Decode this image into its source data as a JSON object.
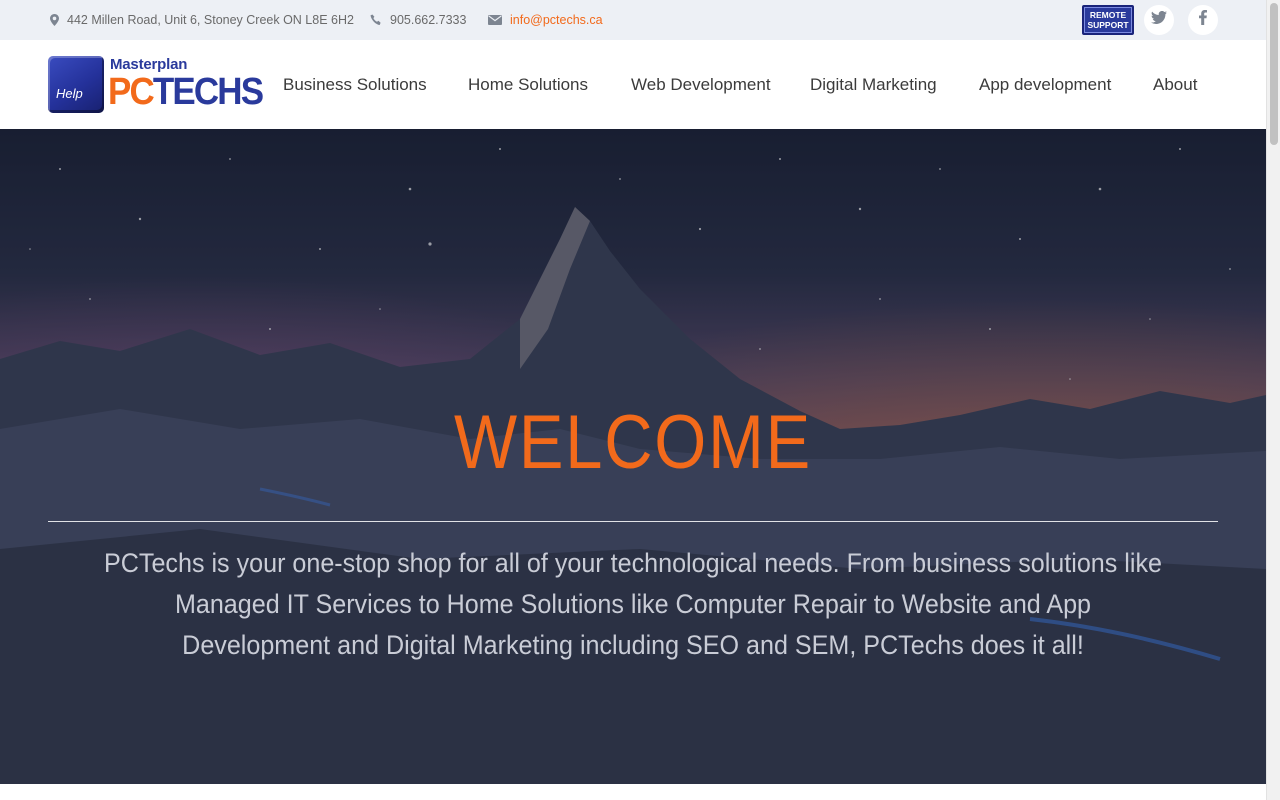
{
  "topbar": {
    "address": "442 Millen Road, Unit 6, Stoney Creek ON L8E 6H2",
    "phone": "905.662.7333",
    "email": "info@pctechs.ca",
    "remote_support_line1": "REMOTE",
    "remote_support_line2": "SUPPORT",
    "icons": [
      "map-marker-icon",
      "phone-icon",
      "envelope-icon",
      "twitter-icon",
      "facebook-icon"
    ]
  },
  "logo": {
    "key_label": "Help",
    "small": "Masterplan",
    "big_pc": "PC",
    "big_techs": "TECHS"
  },
  "nav": {
    "items": [
      {
        "label": "Business Solutions"
      },
      {
        "label": "Home Solutions"
      },
      {
        "label": "Web Development"
      },
      {
        "label": "Digital Marketing"
      },
      {
        "label": "App development"
      },
      {
        "label": "About"
      }
    ]
  },
  "hero": {
    "title": "WELCOME",
    "text": "PCTechs is your one-stop shop for all of your technological needs. From business solutions like Managed IT Services to Home Solutions like Computer Repair to Website and App Development and Digital Marketing including SEO and SEM, PCTechs does it all!"
  },
  "colors": {
    "accent": "#f26a1b",
    "brand_blue": "#2a3a9c",
    "topbar_bg": "#edf0f5"
  }
}
